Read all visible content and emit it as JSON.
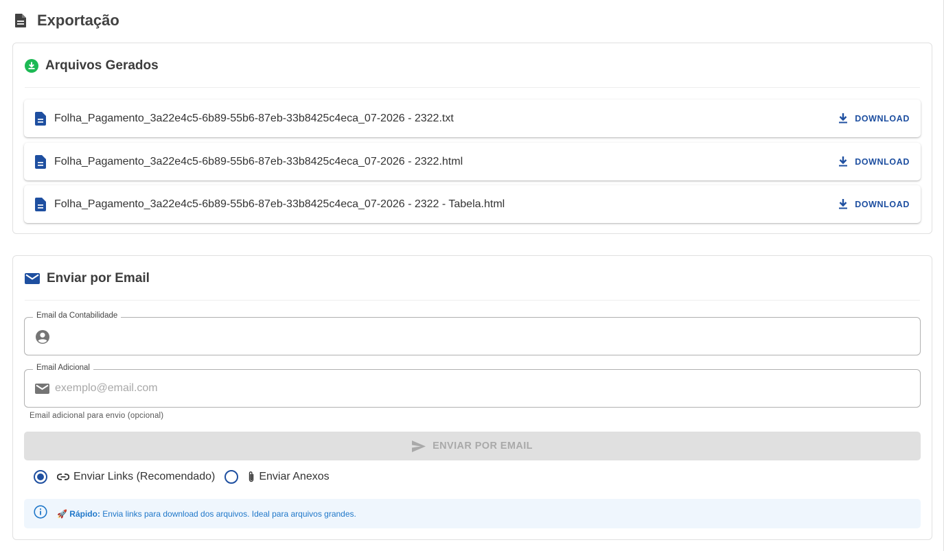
{
  "page": {
    "title": "Exportação"
  },
  "files_section": {
    "title": "Arquivos Gerados",
    "files": [
      {
        "name": "Folha_Pagamento_3a22e4c5-6b89-55b6-87eb-33b8425c4eca_07-2026 - 2322.txt",
        "action": "DOWNLOAD"
      },
      {
        "name": "Folha_Pagamento_3a22e4c5-6b89-55b6-87eb-33b8425c4eca_07-2026 - 2322.html",
        "action": "DOWNLOAD"
      },
      {
        "name": "Folha_Pagamento_3a22e4c5-6b89-55b6-87eb-33b8425c4eca_07-2026 - 2322 - Tabela.html",
        "action": "DOWNLOAD"
      }
    ]
  },
  "email_section": {
    "title": "Enviar por Email",
    "accounting_email": {
      "label": "Email da Contabilidade",
      "value": "",
      "placeholder": ""
    },
    "additional_email": {
      "label": "Email Adicional",
      "value": "",
      "placeholder": "exemplo@email.com",
      "hint": "Email adicional para envio (opcional)"
    },
    "send_button": "ENVIAR POR EMAIL",
    "options": [
      {
        "label": "Enviar Links (Recomendado)",
        "checked": true
      },
      {
        "label": "Enviar Anexos",
        "checked": false
      }
    ],
    "info": {
      "emoji": "🚀",
      "strong": "Rápido:",
      "text": " Envia links para download dos arquivos. Ideal para arquivos grandes."
    }
  },
  "colors": {
    "primary": "#1e4fa0",
    "success": "#1db954",
    "info_bg": "#eff6fd",
    "info_text": "#1f77c9",
    "disabled_bg": "#e0e0e0"
  }
}
